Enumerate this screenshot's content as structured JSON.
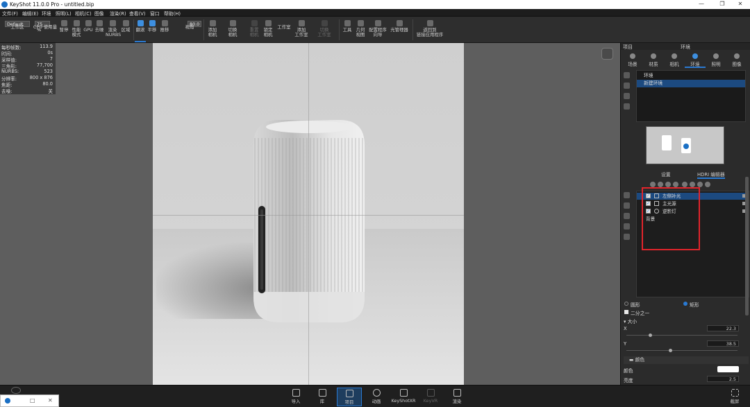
{
  "window": {
    "title": "KeyShot 11.0.0 Pro  - untitled.bip",
    "minimize": "—",
    "maximize": "❐",
    "close": "✕"
  },
  "menu": [
    "文件(F)",
    "编辑(E)",
    "环境",
    "照明(L)",
    "相机(C)",
    "图像",
    "渲染(R)",
    "查看(V)",
    "窗口",
    "帮助(H)"
  ],
  "toolbar": {
    "preset": "Default",
    "percent": "75 %",
    "fov": "80.0",
    "items": [
      {
        "label": "工作区",
        "state": "normal"
      },
      {
        "label": "CPU 使用量",
        "state": "normal"
      },
      {
        "label": "暂停",
        "state": "normal"
      },
      {
        "label": "性能\n模式",
        "state": "normal"
      },
      {
        "label": "GPU",
        "state": "normal"
      },
      {
        "label": "去噪",
        "state": "normal"
      },
      {
        "label": "渲染\nNURBS",
        "state": "normal"
      },
      {
        "label": "区域",
        "state": "normal"
      },
      {
        "label": "翻滚",
        "state": "selected"
      },
      {
        "label": "平移",
        "state": "blue"
      },
      {
        "label": "推移",
        "state": "normal"
      },
      {
        "label": "视角",
        "state": "normal"
      },
      {
        "label": "添加\n相机",
        "state": "normal"
      },
      {
        "label": "切换\n相机",
        "state": "normal"
      },
      {
        "label": "重置\n相机",
        "state": "dim"
      },
      {
        "label": "锁定\n相机",
        "state": "normal"
      },
      {
        "label": "工作室",
        "state": "normal"
      },
      {
        "label": "添加\n工作室",
        "state": "normal"
      },
      {
        "label": "切换\n工作室",
        "state": "dim"
      },
      {
        "label": "工具",
        "state": "normal"
      },
      {
        "label": "几何\n视图",
        "state": "normal"
      },
      {
        "label": "配置程序\n向导",
        "state": "normal"
      },
      {
        "label": "光管理器",
        "state": "normal"
      },
      {
        "label": "返回到\n链接应用程序",
        "state": "normal"
      }
    ]
  },
  "stats": [
    {
      "k": "每秒帧数:",
      "v": "113.9"
    },
    {
      "k": "时间:",
      "v": "0s"
    },
    {
      "k": "采样值:",
      "v": "7"
    },
    {
      "k": "三角形:",
      "v": "77,700"
    },
    {
      "k": "NURBS:",
      "v": "523"
    },
    {
      "k": "分辨率:",
      "v": "800 x 876"
    },
    {
      "k": "焦距:",
      "v": "80.0"
    },
    {
      "k": "去噪:",
      "v": "关"
    }
  ],
  "bottom": [
    {
      "label": "导入",
      "state": "normal"
    },
    {
      "label": "库",
      "state": "normal"
    },
    {
      "label": "项目",
      "state": "selected"
    },
    {
      "label": "动画",
      "state": "normal"
    },
    {
      "label": "KeyShotXR",
      "state": "normal"
    },
    {
      "label": "KeyVR",
      "state": "dim"
    },
    {
      "label": "渲染",
      "state": "normal"
    }
  ],
  "bottom_right": "截屏",
  "panel": {
    "left_title": "项目",
    "title": "环境",
    "tabs": [
      {
        "label": "场景",
        "selected": false
      },
      {
        "label": "材质",
        "selected": false
      },
      {
        "label": "相机",
        "selected": false
      },
      {
        "label": "环境",
        "selected": true
      },
      {
        "label": "照明",
        "selected": false
      },
      {
        "label": "图像",
        "selected": false
      }
    ],
    "env_list": [
      {
        "label": "环境",
        "selected": false
      },
      {
        "label": "新建环境",
        "selected": true
      }
    ],
    "subtabs": [
      "设置",
      "HDRI 编辑器"
    ],
    "layers": [
      {
        "label": "左侧补光",
        "checked": true,
        "selected": true
      },
      {
        "label": "主光源",
        "checked": true,
        "selected": false
      },
      {
        "label": "逆影灯",
        "checked": true,
        "selected": false
      },
      {
        "label": "背景",
        "checked": false,
        "selected": false
      }
    ],
    "shape": {
      "option1": "圆形",
      "option2": "矩形",
      "selected": "矩形"
    },
    "half": "二分之一",
    "size_header": "▾ 大小",
    "x_label": "X",
    "x_value": "22.3",
    "y_label": "Y",
    "y_value": "38.5",
    "color_section": "▬ 颜色",
    "color_label": "颜色",
    "color_swatch": "#ffffff",
    "brightness_label": "亮度",
    "brightness_value": "2.5"
  }
}
